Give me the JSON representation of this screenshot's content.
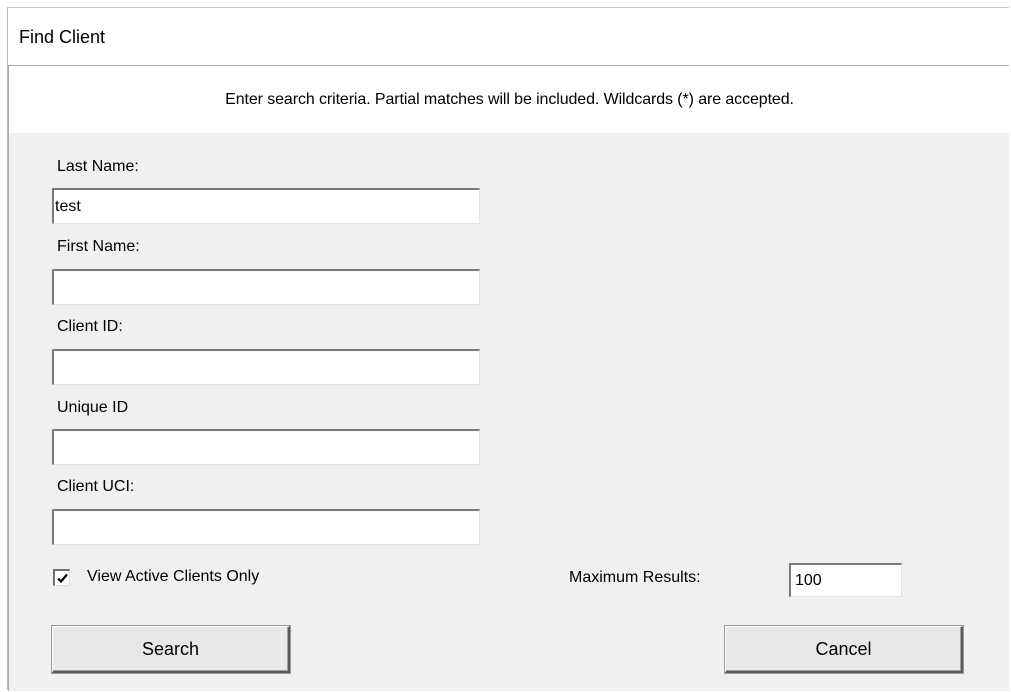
{
  "window": {
    "title": "Find Client"
  },
  "banner": {
    "instructions": "Enter search criteria. Partial matches will be included. Wildcards (*) are accepted."
  },
  "form": {
    "last_name": {
      "label": "Last Name:",
      "value": "test"
    },
    "first_name": {
      "label": "First Name:",
      "value": ""
    },
    "client_id": {
      "label": "Client ID:",
      "value": ""
    },
    "unique_id": {
      "label": "Unique ID",
      "value": ""
    },
    "client_uci": {
      "label": "Client UCI:",
      "value": ""
    },
    "active_only": {
      "label": "View Active Clients Only",
      "checked": true
    },
    "max_results": {
      "label": "Maximum Results:",
      "value": "100"
    }
  },
  "buttons": {
    "search": "Search",
    "cancel": "Cancel"
  },
  "icons": {
    "checkbox_mark": "checkmark-icon"
  }
}
